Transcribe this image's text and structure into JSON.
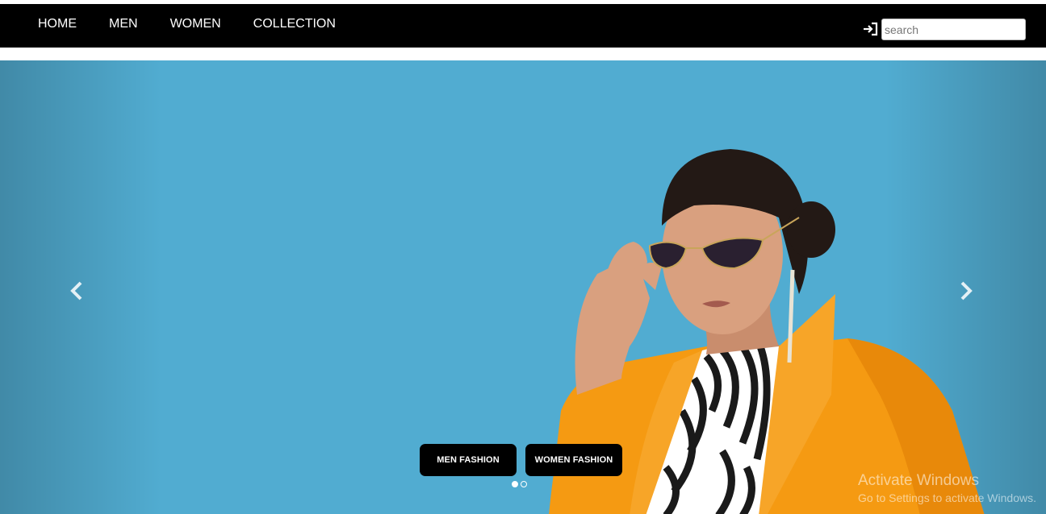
{
  "nav": {
    "links": [
      "HOME",
      "MEN",
      "WOMEN",
      "COLLECTION"
    ],
    "login_icon": "sign-in-icon",
    "search_placeholder": "search"
  },
  "carousel": {
    "buttons": {
      "men": "MEN FASHION",
      "women": "WOMEN FASHION"
    },
    "prev_icon": "chevron-left-icon",
    "next_icon": "chevron-right-icon",
    "slides": 2,
    "active_slide": 1
  },
  "watermark": {
    "title": "Activate Windows",
    "subtitle": "Go to Settings to activate Windows."
  },
  "colors": {
    "nav_bg": "#000000",
    "hero_bg": "#51acd1",
    "jacket": "#f59a12",
    "button_bg": "#000000"
  }
}
